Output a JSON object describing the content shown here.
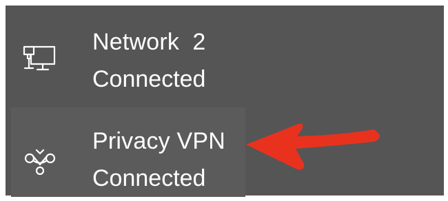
{
  "connections": [
    {
      "name": "Network  2",
      "status": "Connected",
      "icon": "wired-network-icon"
    },
    {
      "name": "Privacy VPN",
      "status": "Connected",
      "icon": "vpn-icon"
    }
  ],
  "annotation": {
    "arrow_color": "#e8321e",
    "points_to": "Privacy VPN"
  },
  "colors": {
    "panel_background": "#555555",
    "text": "#ffffff"
  }
}
